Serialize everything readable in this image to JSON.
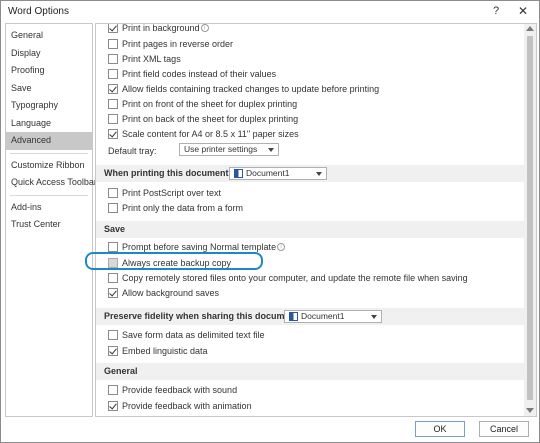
{
  "window": {
    "title": "Word Options",
    "help": "?",
    "close": "✕"
  },
  "sidebar": {
    "items": [
      {
        "label": "General"
      },
      {
        "label": "Display"
      },
      {
        "label": "Proofing"
      },
      {
        "label": "Save"
      },
      {
        "label": "Typography"
      },
      {
        "label": "Language"
      },
      {
        "label": "Advanced"
      },
      {
        "label": "Customize Ribbon"
      },
      {
        "label": "Quick Access Toolbar"
      },
      {
        "label": "Add-ins"
      },
      {
        "label": "Trust Center"
      }
    ],
    "selected": "Advanced"
  },
  "print_options": [
    {
      "label": "Print in background",
      "checked": true
    },
    {
      "label": "Print pages in reverse order",
      "checked": false
    },
    {
      "label": "Print XML tags",
      "checked": false
    },
    {
      "label": "Print field codes instead of their values",
      "checked": false
    },
    {
      "label": "Allow fields containing tracked changes to update before printing",
      "checked": true
    },
    {
      "label": "Print on front of the sheet for duplex printing",
      "checked": false
    },
    {
      "label": "Print on back of the sheet for duplex printing",
      "checked": false
    },
    {
      "label": "Scale content for A4 or 8.5 x 11\" paper sizes",
      "checked": true
    }
  ],
  "default_tray": {
    "label": "Default tray:",
    "value": "Use printer settings"
  },
  "when_printing": {
    "header": "When printing this document:",
    "document": "Document1",
    "options": [
      {
        "label": "Print PostScript over text",
        "checked": false
      },
      {
        "label": "Print only the data from a form",
        "checked": false
      }
    ]
  },
  "save_section": {
    "header": "Save",
    "options": [
      {
        "label": "Prompt before saving Normal template",
        "checked": false
      },
      {
        "label": "Always create backup copy",
        "checked": false
      },
      {
        "label": "Copy remotely stored files onto your computer, and update the remote file when saving",
        "checked": false
      },
      {
        "label": "Allow background saves",
        "checked": true
      }
    ]
  },
  "preserve_fidelity": {
    "header": "Preserve fidelity when sharing this document:",
    "document": "Document1",
    "options": [
      {
        "label": "Save form data as delimited text file",
        "checked": false
      },
      {
        "label": "Embed linguistic data",
        "checked": true
      }
    ]
  },
  "general_section": {
    "header": "General",
    "options": [
      {
        "label": "Provide feedback with sound",
        "checked": false
      },
      {
        "label": "Provide feedback with animation",
        "checked": true
      }
    ]
  },
  "buttons": {
    "ok": "OK",
    "cancel": "Cancel"
  },
  "colors": {
    "accent": "#1e88c7",
    "selected_nav": "#c8c8c8",
    "section_bg": "#f0f0f0"
  }
}
